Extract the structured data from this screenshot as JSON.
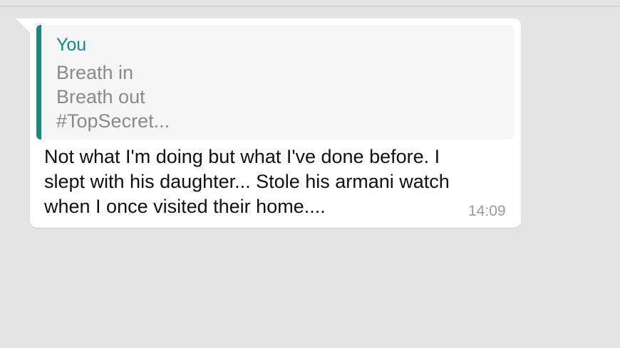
{
  "quote": {
    "author": "You",
    "lines": [
      "Breath in",
      "Breath out",
      "#TopSecret..."
    ]
  },
  "message": {
    "lines": [
      "Not what I'm doing but what I've done before. I",
      "slept with his daughter... Stole his armani watch",
      "when I once visited their home...."
    ],
    "time": "14:09"
  },
  "colors": {
    "background": "#e4e4e4",
    "bubble": "#ffffff",
    "quote_accent": "#128c7e"
  }
}
